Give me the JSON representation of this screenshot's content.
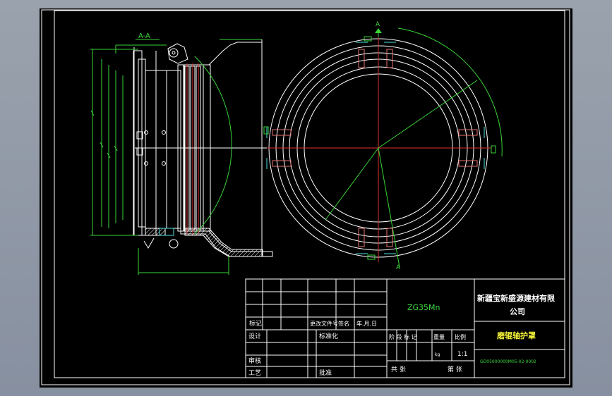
{
  "drawing": {
    "section_label": "A-A",
    "cut_marker_top": "A",
    "cut_marker_bottom": "A"
  },
  "title_block": {
    "material": "ZG35Mn",
    "company_line1": "新疆宝新盛源建材有限",
    "company_line2": "公司",
    "part_name": "磨辊轴护罩",
    "drawing_number": "GD05000000M05-02-0002",
    "scale_value": "1:1",
    "weight_value": "kg",
    "labels": {
      "mark": "标记",
      "count": "数量",
      "zone": "分区",
      "change_doc": "更改文件号",
      "signature": "签名",
      "date": "年.月.日",
      "design": "设计",
      "standardize": "标准化",
      "stage_mark": "阶 段 标 记",
      "weight": "重量",
      "scale": "比例",
      "review": "审核",
      "process": "工艺",
      "approve": "批准",
      "total": "共  张",
      "sheet": "第  张"
    }
  },
  "colors": {
    "background": "#000000",
    "frame": "#ffffff",
    "outline": "#ffffff",
    "dimension": "#39d439",
    "centerline": "#e03030",
    "hatch": "#f5f5f5",
    "cyan": "#4de0e0",
    "yellow": "#f2f23a"
  }
}
